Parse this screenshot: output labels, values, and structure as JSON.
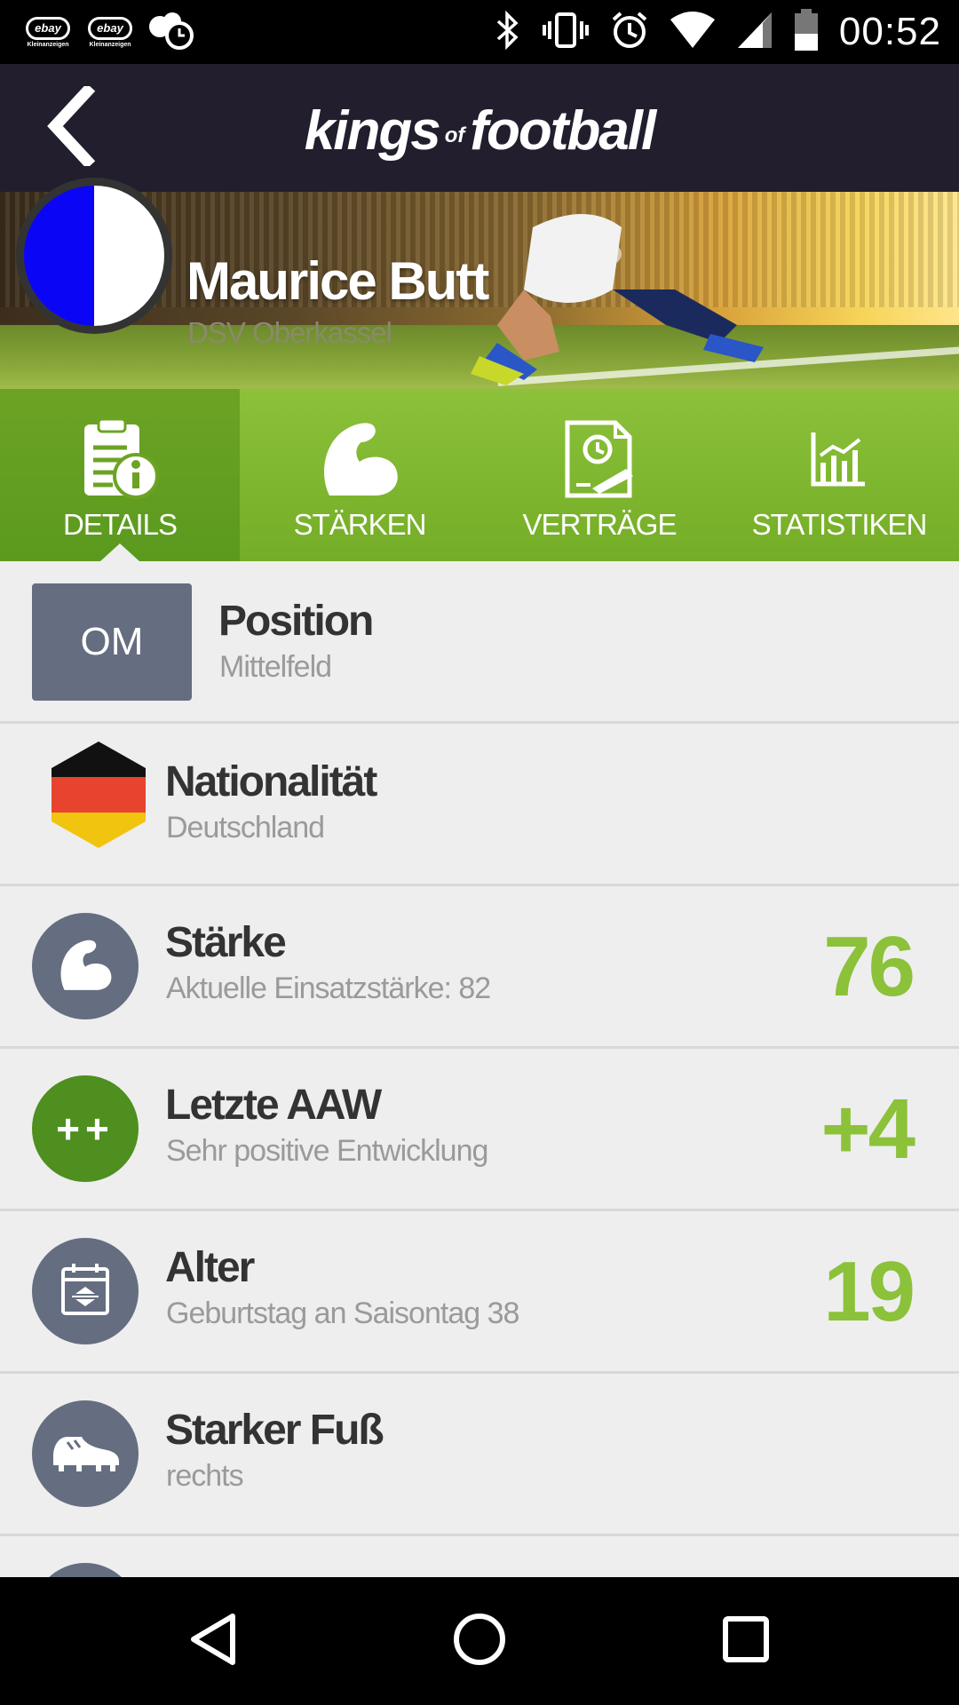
{
  "status_bar": {
    "notifications": [
      {
        "name": "ebay-kleinanzeigen-icon",
        "logo": "ebay",
        "sub": "Kleinanzeigen"
      },
      {
        "name": "ebay-kleinanzeigen-icon",
        "logo": "ebay",
        "sub": "Kleinanzeigen"
      }
    ],
    "time": "00:52",
    "icons": [
      "bluetooth-icon",
      "vibrate-icon",
      "alarm-icon",
      "wifi-icon",
      "signal-icon",
      "battery-icon"
    ]
  },
  "app_bar": {
    "logo_part1": "kings",
    "logo_part2": "of",
    "logo_part3": "football",
    "back_icon": "chevron-left-icon"
  },
  "player": {
    "name": "Maurice Butt",
    "club": "DSV Oberkassel"
  },
  "tabs": [
    {
      "label": "DETAILS",
      "icon": "details-icon",
      "active": true
    },
    {
      "label": "STÄRKEN",
      "icon": "muscle-icon",
      "active": false
    },
    {
      "label": "VERTRÄGE",
      "icon": "contract-icon",
      "active": false
    },
    {
      "label": "STATISTIKEN",
      "icon": "chart-icon",
      "active": false
    }
  ],
  "details": {
    "position": {
      "badge": "OM",
      "title": "Position",
      "subtitle": "Mittelfeld"
    },
    "nationality": {
      "title": "Nationalität",
      "subtitle": "Deutschland"
    },
    "strength": {
      "title": "Stärke",
      "subtitle": "Aktuelle Einsatzstärke: 82",
      "value": "76"
    },
    "last_aaw": {
      "badge": "++",
      "title": "Letzte AAW",
      "subtitle": "Sehr positive Entwicklung",
      "value": "+4"
    },
    "age": {
      "title": "Alter",
      "subtitle": "Geburtstag an Saisontag 38",
      "value": "19"
    },
    "strong_foot": {
      "title": "Starker Fuß",
      "subtitle": "rechts"
    }
  },
  "colors": {
    "accent_green": "#8cc13a",
    "dark_header": "#221e2d",
    "icon_circle": "#656d80",
    "aaw_green": "#4e8f1f"
  }
}
